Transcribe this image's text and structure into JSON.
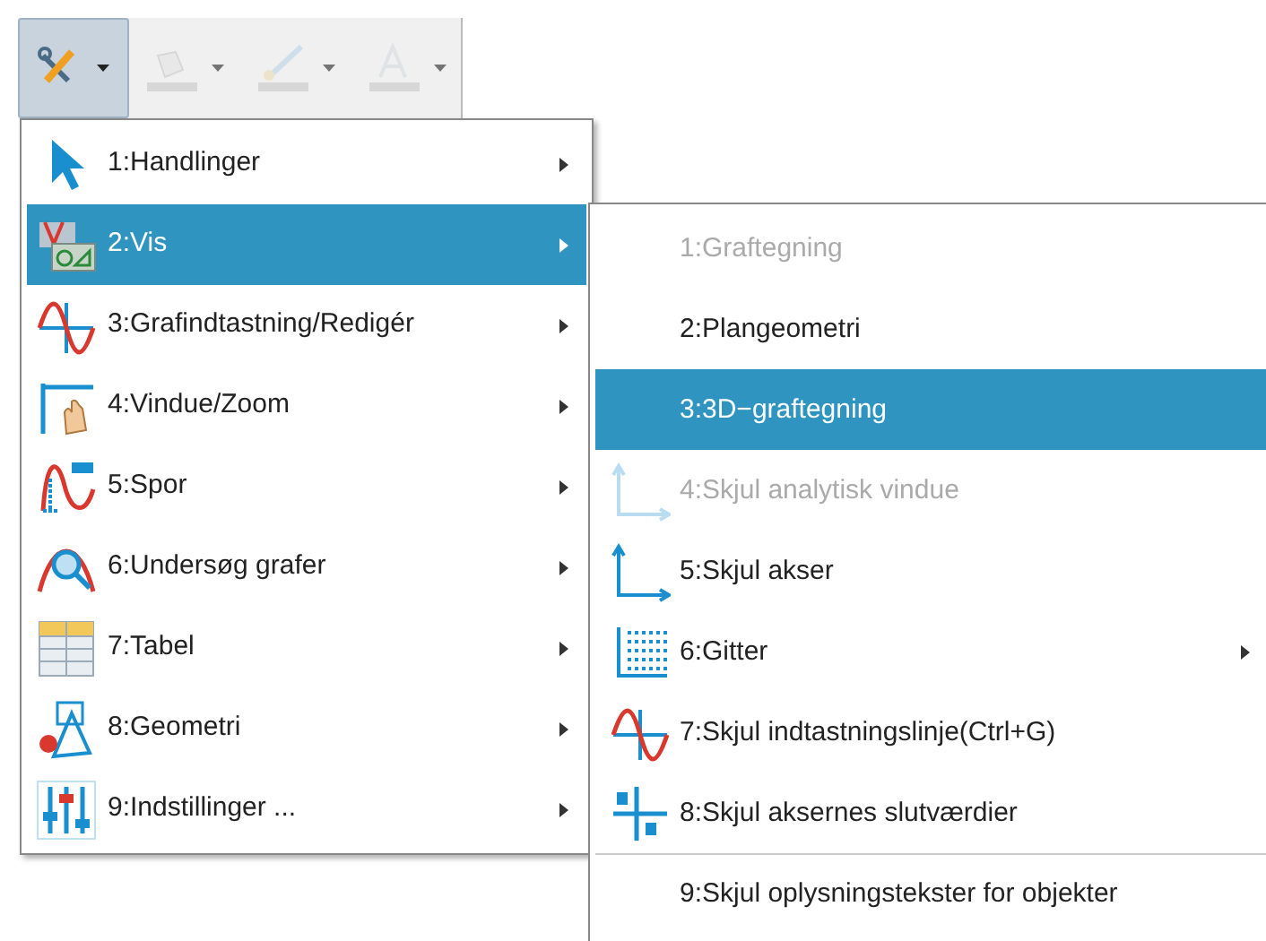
{
  "toolbar": [
    {
      "pressed": true,
      "disabled": false
    },
    {
      "pressed": false,
      "disabled": true
    },
    {
      "pressed": false,
      "disabled": true
    },
    {
      "pressed": false,
      "disabled": true
    }
  ],
  "menu": [
    {
      "label": "1:Handlinger",
      "selected": false,
      "has_submenu": true
    },
    {
      "label": "2:Vis",
      "selected": true,
      "has_submenu": true
    },
    {
      "label": "3:Grafindtastning/Redigér",
      "selected": false,
      "has_submenu": true
    },
    {
      "label": "4:Vindue/Zoom",
      "selected": false,
      "has_submenu": true
    },
    {
      "label": "5:Spor",
      "selected": false,
      "has_submenu": true
    },
    {
      "label": "6:Undersøg grafer",
      "selected": false,
      "has_submenu": true
    },
    {
      "label": "7:Tabel",
      "selected": false,
      "has_submenu": true
    },
    {
      "label": "8:Geometri",
      "selected": false,
      "has_submenu": true
    },
    {
      "label": "9:Indstillinger ...",
      "selected": false,
      "has_submenu": true
    }
  ],
  "submenu": [
    {
      "label": "1:Graftegning",
      "selected": false,
      "disabled": true,
      "has_submenu": false,
      "divider_before": false
    },
    {
      "label": "2:Plangeometri",
      "selected": false,
      "disabled": false,
      "has_submenu": false,
      "divider_before": false
    },
    {
      "label": "3:3D−graftegning",
      "selected": true,
      "disabled": false,
      "has_submenu": false,
      "divider_before": false
    },
    {
      "label": "4:Skjul analytisk vindue",
      "selected": false,
      "disabled": true,
      "has_submenu": false,
      "divider_before": false
    },
    {
      "label": "5:Skjul akser",
      "selected": false,
      "disabled": false,
      "has_submenu": false,
      "divider_before": false
    },
    {
      "label": "6:Gitter",
      "selected": false,
      "disabled": false,
      "has_submenu": true,
      "divider_before": false
    },
    {
      "label": "7:Skjul indtastningslinje(Ctrl+G)",
      "selected": false,
      "disabled": false,
      "has_submenu": false,
      "divider_before": false
    },
    {
      "label": "8:Skjul aksernes slutværdier",
      "selected": false,
      "disabled": false,
      "has_submenu": false,
      "divider_before": false
    },
    {
      "label": "9:Skjul oplysningstekster for objekter",
      "selected": false,
      "disabled": false,
      "has_submenu": false,
      "divider_before": true
    }
  ]
}
